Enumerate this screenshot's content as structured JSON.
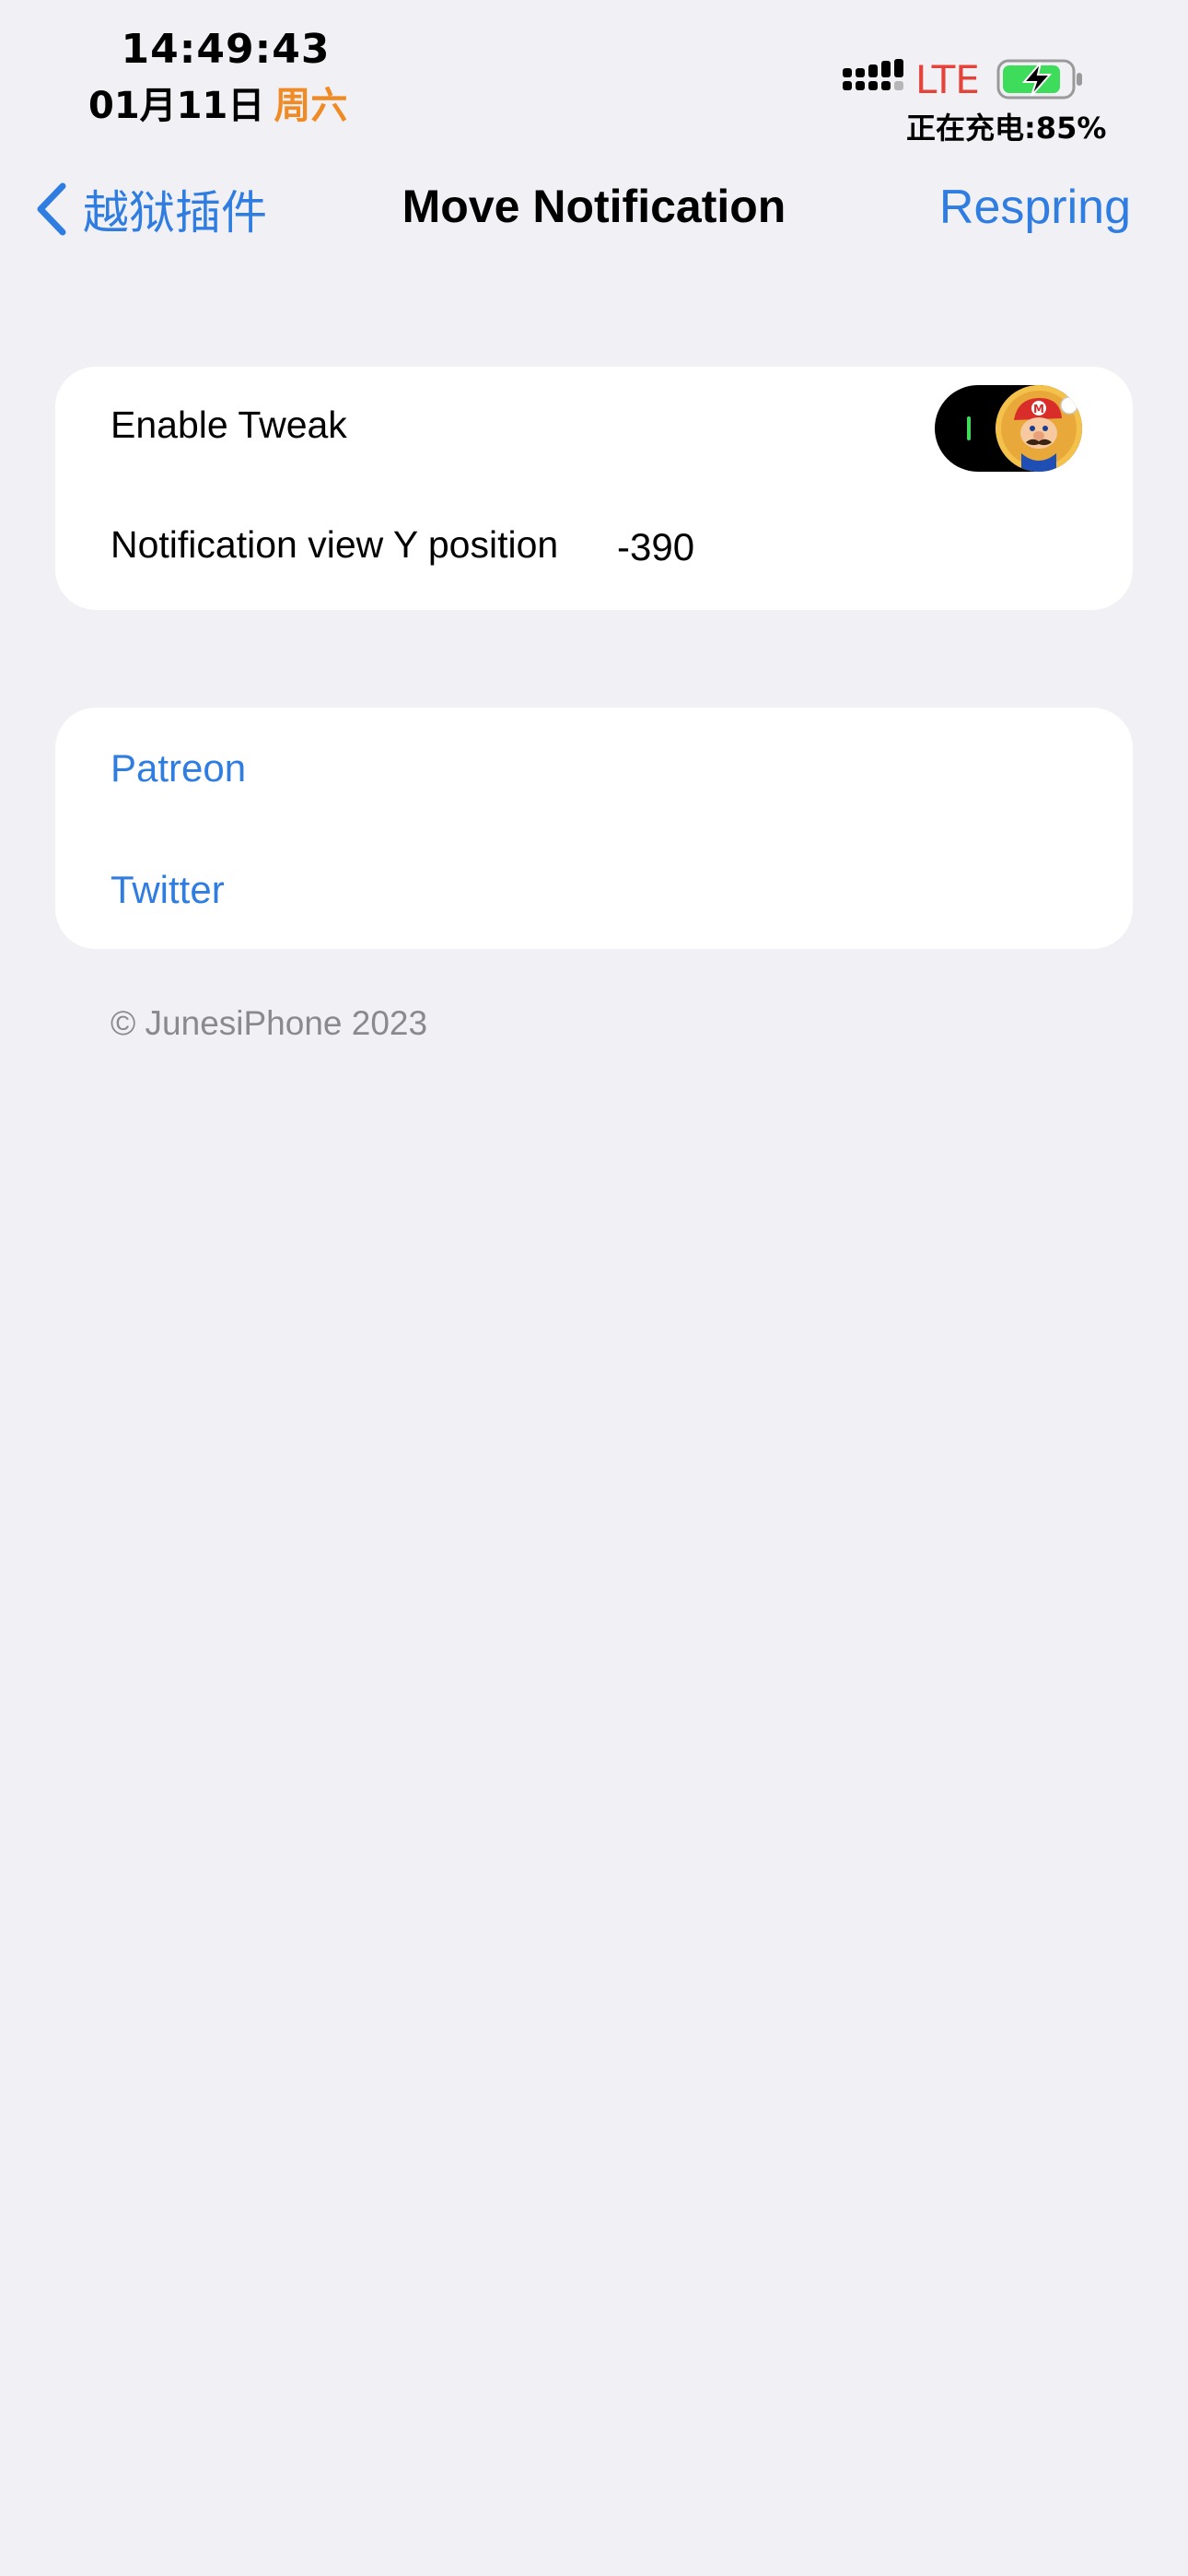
{
  "status_bar": {
    "time": "14:49:43",
    "date": "01月11日",
    "weekday": "周六",
    "network": "LTE",
    "charging": "正在充电:85%",
    "battery_level_percent": 85,
    "colors": {
      "weekday": "#f08a24",
      "network": "#e5423a",
      "battery": "#3ddc5b"
    }
  },
  "nav": {
    "back_label": "越狱插件",
    "title": "Move Notification",
    "action_label": "Respring",
    "accent": "#2f7de1"
  },
  "settings": {
    "enable_tweak": {
      "label": "Enable Tweak",
      "enabled": true
    },
    "y_position": {
      "label": "Notification view Y position",
      "value": "-390"
    }
  },
  "links": {
    "patreon": "Patreon",
    "twitter": "Twitter"
  },
  "footer": "© JunesiPhone 2023",
  "icons": {
    "back": "chevron-left-icon",
    "signal": "cellular-signal-icon",
    "battery": "battery-charging-icon",
    "toggle_thumb": "mario-avatar-icon"
  }
}
